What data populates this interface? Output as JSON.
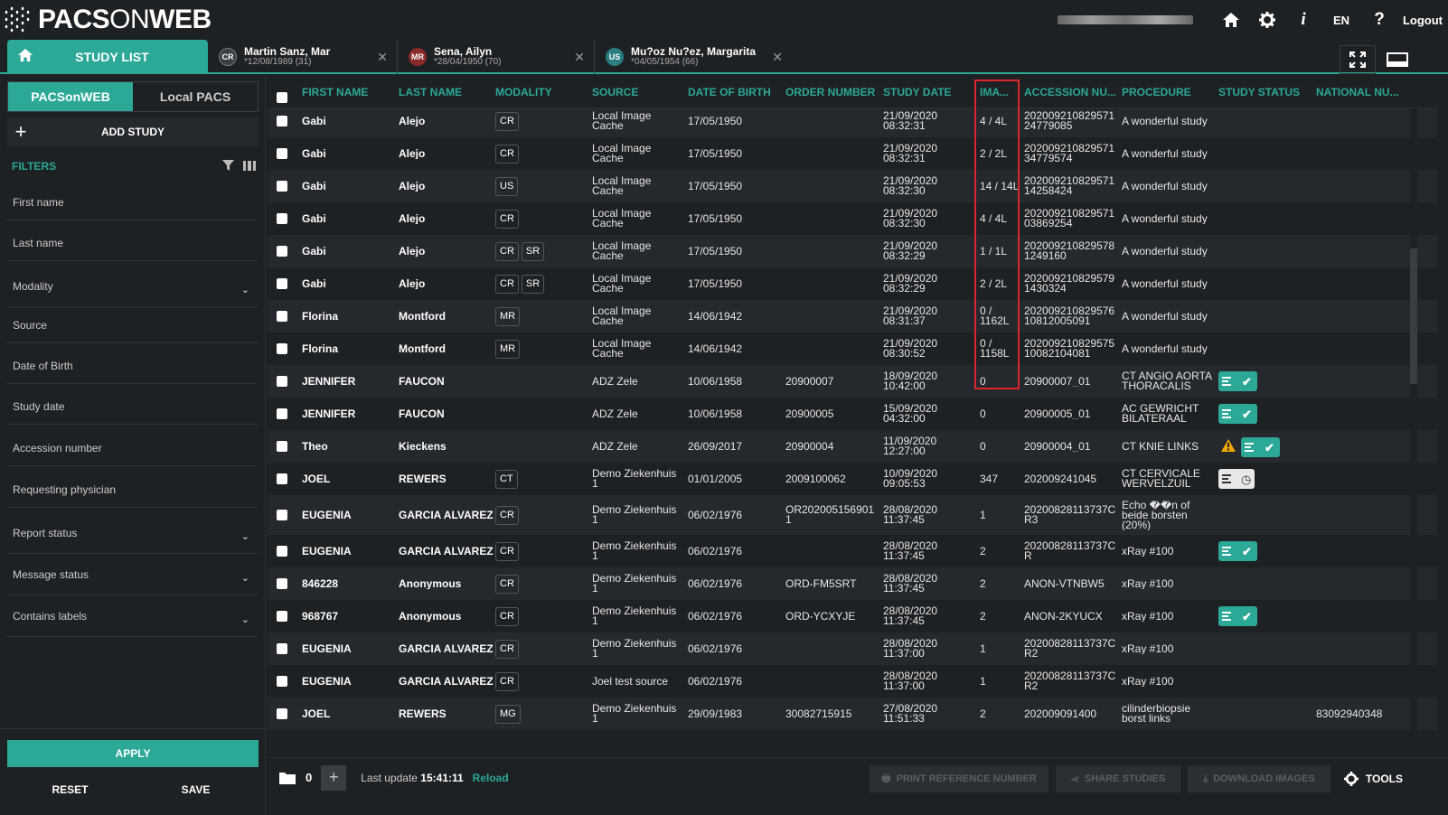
{
  "app": {
    "logo_text_1": "PACS",
    "logo_text_on": "ON",
    "logo_text_2": "WEB"
  },
  "topbar": {
    "lang": "EN",
    "help": "?",
    "logout": "Logout",
    "info": "i"
  },
  "tabs": {
    "study_list": "STUDY LIST",
    "patients": [
      {
        "badge": "CR",
        "badge_color": "#3a3e42",
        "name": "Martin Sanz, Mar",
        "dob": "*12/08/1989 (31)"
      },
      {
        "badge": "MR",
        "badge_color": "#8b2a2a",
        "name": "Sena, Ailyn",
        "dob": "*28/04/1950 (70)"
      },
      {
        "badge": "US",
        "badge_color": "#2a7d80",
        "name": "Mu?oz Nu?ez, Margarita",
        "dob": "*04/05/1954 (66)"
      }
    ]
  },
  "sidebar": {
    "source_tabs": [
      "PACSonWEB",
      "Local PACS"
    ],
    "add_study": "ADD STUDY",
    "filters_label": "FILTERS",
    "filters": [
      {
        "label": "First name",
        "dropdown": false
      },
      {
        "label": "Last name",
        "dropdown": false
      },
      {
        "label": "Modality",
        "dropdown": true
      },
      {
        "label": "Source",
        "dropdown": false
      },
      {
        "label": "Date of Birth",
        "dropdown": false
      },
      {
        "label": "Study date",
        "dropdown": false
      },
      {
        "label": "Accession number",
        "dropdown": false
      },
      {
        "label": "Requesting physician",
        "dropdown": false
      },
      {
        "label": "Report status",
        "dropdown": true
      },
      {
        "label": "Message status",
        "dropdown": true
      },
      {
        "label": "Contains labels",
        "dropdown": true
      }
    ],
    "apply": "APPLY",
    "reset": "RESET",
    "save": "SAVE"
  },
  "table": {
    "headers": [
      "FIRST NAME",
      "LAST NAME",
      "MODALITY",
      "SOURCE",
      "DATE OF BIRTH",
      "ORDER NUMBER",
      "STUDY DATE",
      "IMA...",
      "ACCESSION NU...",
      "PROCEDURE",
      "STUDY STATUS",
      "NATIONAL NU..."
    ],
    "rows": [
      {
        "first": "Gabi",
        "last": "Alejo",
        "mods": [
          "CR"
        ],
        "source": "Local Image Cache",
        "dob": "17/05/1950",
        "order": "",
        "date": "21/09/2020",
        "time": "08:32:31",
        "images": "4 / 4L",
        "acc": "20200921082957124779085",
        "proc": "A wonderful study",
        "status": [],
        "national": ""
      },
      {
        "first": "Gabi",
        "last": "Alejo",
        "mods": [
          "CR"
        ],
        "source": "Local Image Cache",
        "dob": "17/05/1950",
        "order": "",
        "date": "21/09/2020",
        "time": "08:32:31",
        "images": "2 / 2L",
        "acc": "20200921082957134779574",
        "proc": "A wonderful study",
        "status": [],
        "national": ""
      },
      {
        "first": "Gabi",
        "last": "Alejo",
        "mods": [
          "US"
        ],
        "source": "Local Image Cache",
        "dob": "17/05/1950",
        "order": "",
        "date": "21/09/2020",
        "time": "08:32:30",
        "images": "14 / 14L",
        "acc": "20200921082957114258424",
        "proc": "A wonderful study",
        "status": [],
        "national": ""
      },
      {
        "first": "Gabi",
        "last": "Alejo",
        "mods": [
          "CR"
        ],
        "source": "Local Image Cache",
        "dob": "17/05/1950",
        "order": "",
        "date": "21/09/2020",
        "time": "08:32:30",
        "images": "4 / 4L",
        "acc": "20200921082957103869254",
        "proc": "A wonderful study",
        "status": [],
        "national": ""
      },
      {
        "first": "Gabi",
        "last": "Alejo",
        "mods": [
          "CR",
          "SR"
        ],
        "source": "Local Image Cache",
        "dob": "17/05/1950",
        "order": "",
        "date": "21/09/2020",
        "time": "08:32:29",
        "images": "1 / 1L",
        "acc": "2020092108295781249160",
        "proc": "A wonderful study",
        "status": [],
        "national": ""
      },
      {
        "first": "Gabi",
        "last": "Alejo",
        "mods": [
          "CR",
          "SR"
        ],
        "source": "Local Image Cache",
        "dob": "17/05/1950",
        "order": "",
        "date": "21/09/2020",
        "time": "08:32:29",
        "images": "2 / 2L",
        "acc": "2020092108295791430324",
        "proc": "A wonderful study",
        "status": [],
        "national": ""
      },
      {
        "first": "Florina",
        "last": "Montford",
        "mods": [
          "MR"
        ],
        "source": "Local Image Cache",
        "dob": "14/06/1942",
        "order": "",
        "date": "21/09/2020",
        "time": "08:31:37",
        "images": "0 / 1162L",
        "acc": "20200921082957610812005091",
        "proc": "A wonderful study",
        "status": [],
        "national": ""
      },
      {
        "first": "Florina",
        "last": "Montford",
        "mods": [
          "MR"
        ],
        "source": "Local Image Cache",
        "dob": "14/06/1942",
        "order": "",
        "date": "21/09/2020",
        "time": "08:30:52",
        "images": "0 / 1158L",
        "acc": "20200921082957510082104081",
        "proc": "A wonderful study",
        "status": [],
        "national": ""
      },
      {
        "first": "JENNIFER",
        "last": "FAUCON",
        "mods": [],
        "source": "ADZ Zele",
        "dob": "10/06/1958",
        "order": "20900007",
        "date": "18/09/2020",
        "time": "10:42:00",
        "images": "0",
        "acc": "20900007_01",
        "proc": "CT ANGIO AORTA THORACALIS",
        "status": [
          "green"
        ],
        "national": ""
      },
      {
        "first": "JENNIFER",
        "last": "FAUCON",
        "mods": [],
        "source": "ADZ Zele",
        "dob": "10/06/1958",
        "order": "20900005",
        "date": "15/09/2020",
        "time": "04:32:00",
        "images": "0",
        "acc": "20900005_01",
        "proc": "AC GEWRICHT BILATERAAL",
        "status": [
          "green"
        ],
        "national": ""
      },
      {
        "first": "Theo",
        "last": "Kieckens",
        "mods": [],
        "source": "ADZ Zele",
        "dob": "26/09/2017",
        "order": "20900004",
        "date": "11/09/2020",
        "time": "12:27:00",
        "images": "0",
        "acc": "20900004_01",
        "proc": "CT KNIE LINKS",
        "status": [
          "warn",
          "green"
        ],
        "national": ""
      },
      {
        "first": "JOEL",
        "last": "REWERS",
        "mods": [
          "CT"
        ],
        "source": "Demo Ziekenhuis 1",
        "dob": "01/01/2005",
        "order": "2009100062",
        "date": "10/09/2020",
        "time": "09:05:53",
        "images": "347",
        "acc": "202009241045",
        "proc": "CT CERVICALE WERVELZUIL",
        "status": [
          "grey"
        ],
        "national": ""
      },
      {
        "first": "EUGENIA",
        "last": "GARCIA ALVAREZ",
        "mods": [
          "CR"
        ],
        "source": "Demo Ziekenhuis 1",
        "dob": "06/02/1976",
        "order": "OR2020051569011",
        "date": "28/08/2020",
        "time": "11:37:45",
        "images": "1",
        "acc": "20200828113737CR3",
        "proc": "Echo ��n of beide borsten (20%)",
        "status": [],
        "national": ""
      },
      {
        "first": "EUGENIA",
        "last": "GARCIA ALVAREZ",
        "mods": [
          "CR"
        ],
        "source": "Demo Ziekenhuis 1",
        "dob": "06/02/1976",
        "order": "",
        "date": "28/08/2020",
        "time": "11:37:45",
        "images": "2",
        "acc": "20200828113737CR",
        "proc": "xRay #100",
        "status": [
          "green"
        ],
        "national": ""
      },
      {
        "first": "846228",
        "last": "Anonymous",
        "mods": [
          "CR"
        ],
        "source": "Demo Ziekenhuis 1",
        "dob": "06/02/1976",
        "order": "ORD-FM5SRT",
        "date": "28/08/2020",
        "time": "11:37:45",
        "images": "2",
        "acc": "ANON-VTNBW5",
        "proc": "xRay #100",
        "status": [],
        "national": ""
      },
      {
        "first": "968767",
        "last": "Anonymous",
        "mods": [
          "CR"
        ],
        "source": "Demo Ziekenhuis 1",
        "dob": "06/02/1976",
        "order": "ORD-YCXYJE",
        "date": "28/08/2020",
        "time": "11:37:45",
        "images": "2",
        "acc": "ANON-2KYUCX",
        "proc": "xRay #100",
        "status": [
          "green"
        ],
        "national": ""
      },
      {
        "first": "EUGENIA",
        "last": "GARCIA ALVAREZ",
        "mods": [
          "CR"
        ],
        "source": "Demo Ziekenhuis 1",
        "dob": "06/02/1976",
        "order": "",
        "date": "28/08/2020",
        "time": "11:37:00",
        "images": "1",
        "acc": "20200828113737CR2",
        "proc": "xRay #100",
        "status": [],
        "national": ""
      },
      {
        "first": "EUGENIA",
        "last": "GARCIA ALVAREZ",
        "mods": [
          "CR"
        ],
        "source": "Joel test source",
        "dob": "06/02/1976",
        "order": "",
        "date": "28/08/2020",
        "time": "11:37:00",
        "images": "1",
        "acc": "20200828113737CR2",
        "proc": "xRay #100",
        "status": [],
        "national": ""
      },
      {
        "first": "JOEL",
        "last": "REWERS",
        "mods": [
          "MG"
        ],
        "source": "Demo Ziekenhuis 1",
        "dob": "29/09/1983",
        "order": "30082715915",
        "date": "27/08/2020",
        "time": "11:51:33",
        "images": "2",
        "acc": "202009091400",
        "proc": "cilinderbiopsie borst links",
        "status": [],
        "national": "83092940348"
      }
    ]
  },
  "footer": {
    "count": "0",
    "last_update_label": "Last update",
    "last_update_time": "15:41:11",
    "reload": "Reload",
    "print_ref": "PRINT REFERENCE NUMBER",
    "share": "SHARE STUDIES",
    "download": "DOWNLOAD IMAGES",
    "tools": "TOOLS"
  },
  "colors": {
    "accent": "#2ba896",
    "highlight_box": "#d9262b",
    "background": "#1e2124"
  }
}
